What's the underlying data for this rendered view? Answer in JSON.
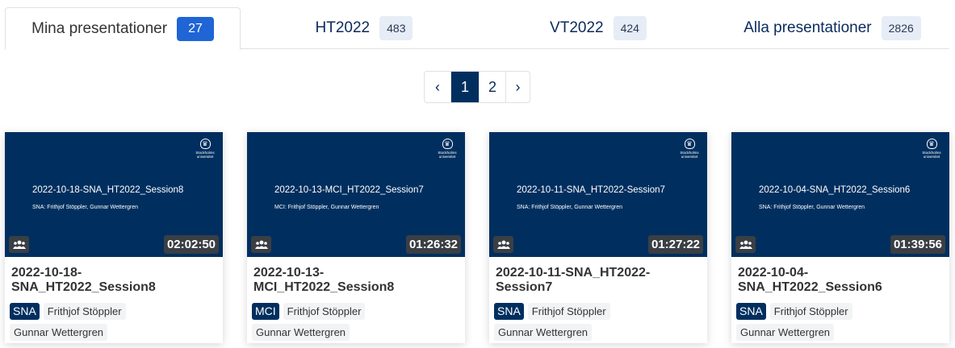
{
  "tabs": [
    {
      "label": "Mina presentationer",
      "count": "27"
    },
    {
      "label": "HT2022",
      "count": "483"
    },
    {
      "label": "VT2022",
      "count": "424"
    },
    {
      "label": "Alla presentationer",
      "count": "2826"
    }
  ],
  "pagination": {
    "prev": "‹",
    "pages": [
      "1",
      "2"
    ],
    "next": "›",
    "current": "1"
  },
  "logo": {
    "name": "Stockholms universitet",
    "line1": "Stockholms",
    "line2": "universitet"
  },
  "cards": [
    {
      "slide_title": "2022-10-18-SNA_HT2022_Session8",
      "slide_sub": "SNA: Frithjof Stöppler, Gunnar Wettergren",
      "duration": "02:02:50",
      "title": "2022-10-18-SNA_HT2022_Session8",
      "course": "SNA",
      "presenters": [
        "Frithjof Stöppler",
        "Gunnar Wettergren"
      ]
    },
    {
      "slide_title": "2022-10-13-MCI_HT2022_Session7",
      "slide_sub": "MCI: Frithjof Stöppler, Gunnar Wettergren",
      "duration": "01:26:32",
      "title": "2022-10-13-MCI_HT2022_Session8",
      "course": "MCI",
      "presenters": [
        "Frithjof Stöppler",
        "Gunnar Wettergren"
      ]
    },
    {
      "slide_title": "2022-10-11-SNA_HT2022-Session7",
      "slide_sub": "SNA: Frithjof Stöppler, Gunnar Wettergren",
      "duration": "01:27:22",
      "title": "2022-10-11-SNA_HT2022-Session7",
      "course": "SNA",
      "presenters": [
        "Frithjof Stöppler",
        "Gunnar Wettergren"
      ]
    },
    {
      "slide_title": "2022-10-04-SNA_HT2022_Session6",
      "slide_sub": "SNA: Frithjof Stöppler, Gunnar Wettergren",
      "duration": "01:39:56",
      "title": "2022-10-04-SNA_HT2022_Session6",
      "course": "SNA",
      "presenters": [
        "Frithjof Stöppler",
        "Gunnar Wettergren"
      ]
    }
  ],
  "icons": {
    "group": "group-users-icon",
    "logo": "university-logo-icon"
  },
  "colors": {
    "navy": "#002f5f",
    "active_badge": "#1f65d6",
    "badge": "#e6edf6",
    "duration_bg": "#3a3f44"
  }
}
